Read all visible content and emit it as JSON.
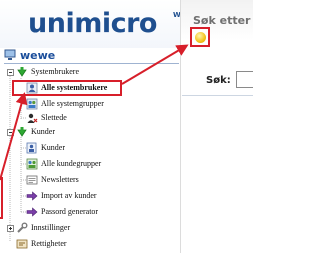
{
  "header": {
    "logo_main": "unimicro",
    "logo_sup": "WEB",
    "right_title": "Søk etter",
    "search_label": "Søk:"
  },
  "tree": {
    "root_label": "wewe",
    "items": [
      {
        "label": "Systembrukere",
        "icon": "folder-green-arrow-icon"
      },
      {
        "label": "Alle systembrukere",
        "icon": "users-icon",
        "selected": true
      },
      {
        "label": "Alle systemgrupper",
        "icon": "group-icon"
      },
      {
        "label": "Slettede",
        "icon": "deleted-user-icon"
      },
      {
        "label": "Kunder",
        "icon": "folder-green-arrow-icon"
      },
      {
        "label": "Kunder",
        "icon": "customer-icon"
      },
      {
        "label": "Alle kundegrupper",
        "icon": "customer-group-icon"
      },
      {
        "label": "Newsletters",
        "icon": "newsletter-icon"
      },
      {
        "label": "Import av kunder",
        "icon": "import-arrow-icon"
      },
      {
        "label": "Passord generator",
        "icon": "password-generator-icon"
      },
      {
        "label": "Innstillinger",
        "icon": "wrench-icon"
      },
      {
        "label": "Rettigheter",
        "icon": "rights-icon"
      }
    ]
  },
  "colors": {
    "brand_blue": "#1f4f8f",
    "annotation_red": "#d71f2a",
    "tree_header_blue": "#1b4e9b"
  }
}
